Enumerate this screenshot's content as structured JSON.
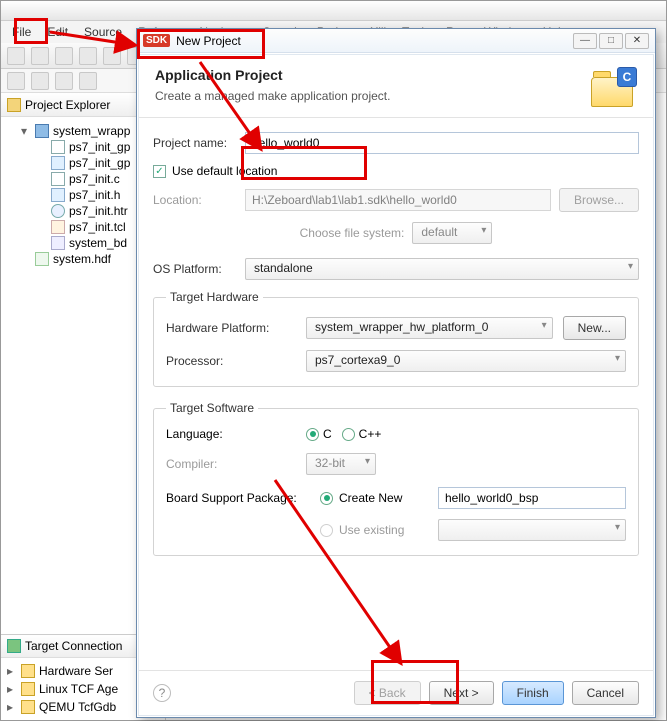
{
  "menu": {
    "file": "File",
    "edit": "Edit",
    "source": "Source",
    "refactor": "Refactor",
    "navigate": "Navigate",
    "search": "Search",
    "project": "Project",
    "xilinx": "Xilinx Tools",
    "run": "Run",
    "window": "Window",
    "help": "Help"
  },
  "explorer": {
    "title": "Project Explorer",
    "root": "system_wrapp",
    "children": [
      "ps7_init_gp",
      "ps7_init_gp",
      "ps7_init.c",
      "ps7_init.h",
      "ps7_init.htr",
      "ps7_init.tcl",
      "system_bd",
      "system.hdf"
    ]
  },
  "target": {
    "title": "Target Connection",
    "items": [
      "Hardware Ser",
      "Linux TCF Age",
      "QEMU TcfGdb"
    ]
  },
  "dialog": {
    "title": "New Project",
    "heading": "Application Project",
    "sub": "Create a managed make application project.",
    "badge_c": "C",
    "project_name_label": "Project name:",
    "project_name_value": "hello_world0",
    "use_default": "Use default location",
    "location_label": "Location:",
    "location_value": "H:\\Zeboard\\lab1\\lab1.sdk\\hello_world0",
    "browse": "Browse...",
    "choose_fs_label": "Choose file system:",
    "choose_fs_value": "default",
    "os_label": "OS Platform:",
    "os_value": "standalone",
    "hw_legend": "Target Hardware",
    "hw_platform_label": "Hardware Platform:",
    "hw_platform_value": "system_wrapper_hw_platform_0",
    "hw_new": "New...",
    "processor_label": "Processor:",
    "processor_value": "ps7_cortexa9_0",
    "sw_legend": "Target Software",
    "language_label": "Language:",
    "lang_c": "C",
    "lang_cpp": "C++",
    "compiler_label": "Compiler:",
    "compiler_value": "32-bit",
    "bsp_label": "Board Support Package:",
    "bsp_create": "Create New",
    "bsp_create_value": "hello_world0_bsp",
    "bsp_existing": "Use existing",
    "back": "< Back",
    "next": "Next >",
    "finish": "Finish",
    "cancel": "Cancel"
  },
  "window_buttons": {
    "min": "—",
    "max": "□",
    "close": "✕"
  }
}
